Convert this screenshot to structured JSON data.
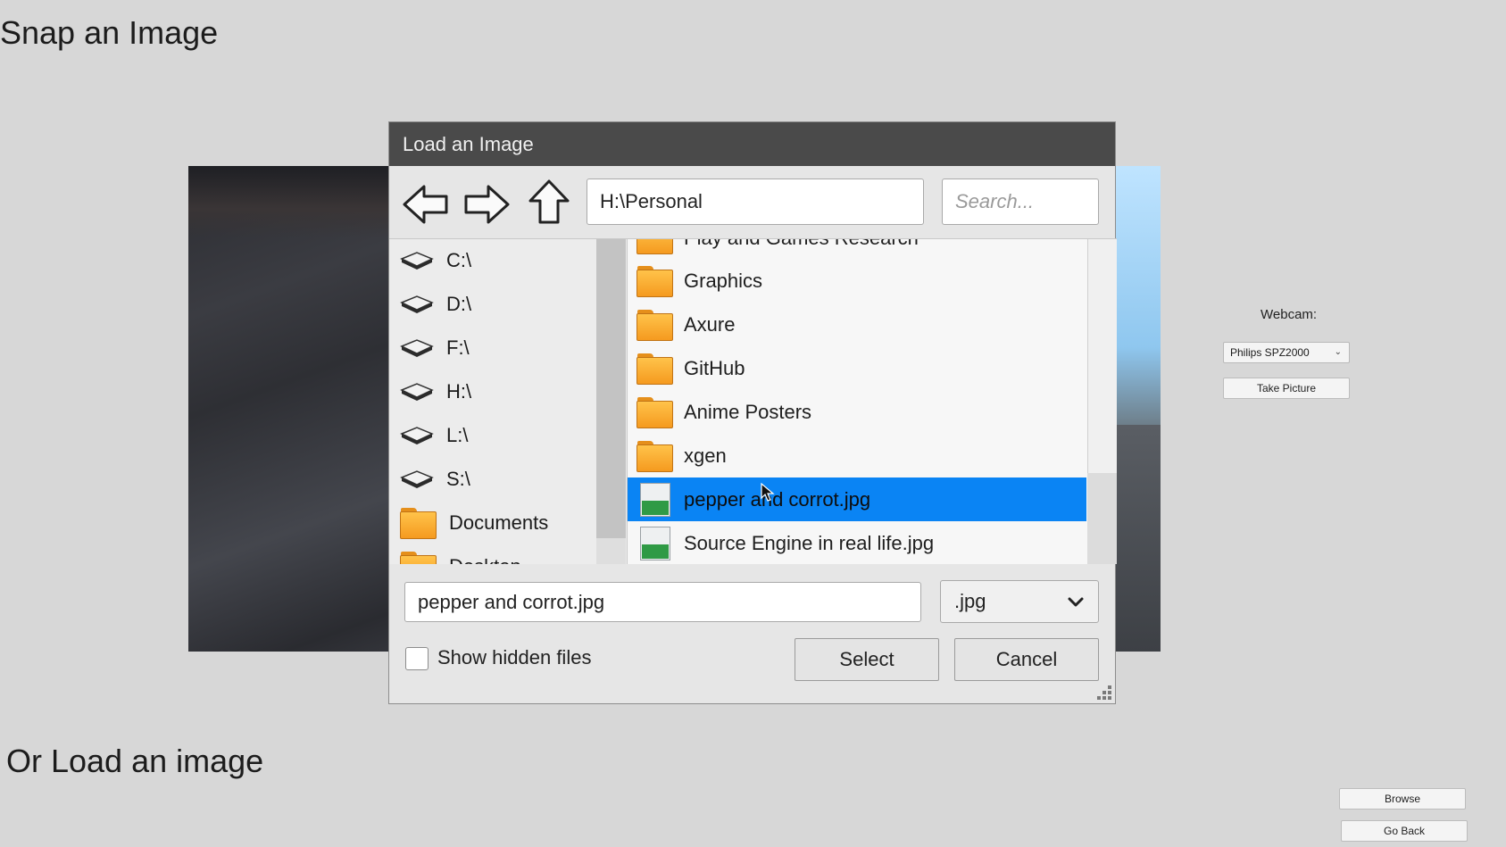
{
  "page": {
    "snap_heading": "Snap an Image",
    "load_heading": "Or Load an image"
  },
  "webcam": {
    "label": "Webcam:",
    "selected_device": "Philips SPZ2000",
    "take_picture_label": "Take Picture"
  },
  "actions": {
    "browse_label": "Browse",
    "go_back_label": "Go Back"
  },
  "dialog": {
    "title": "Load an Image",
    "path": "H:\\Personal",
    "search_placeholder": "Search...",
    "drives": [
      {
        "label": "C:\\",
        "icon": "drive-icon"
      },
      {
        "label": "D:\\",
        "icon": "drive-icon"
      },
      {
        "label": "F:\\",
        "icon": "drive-icon"
      },
      {
        "label": "H:\\",
        "icon": "drive-icon"
      },
      {
        "label": "L:\\",
        "icon": "drive-icon"
      },
      {
        "label": "S:\\",
        "icon": "drive-icon"
      },
      {
        "label": "Documents",
        "icon": "folder-icon"
      },
      {
        "label": "Desktop",
        "icon": "folder-icon"
      }
    ],
    "files": [
      {
        "label": "Play and Games Research",
        "type": "folder"
      },
      {
        "label": "Graphics",
        "type": "folder"
      },
      {
        "label": "Axure",
        "type": "folder"
      },
      {
        "label": "GitHub",
        "type": "folder"
      },
      {
        "label": "Anime Posters",
        "type": "folder"
      },
      {
        "label": "xgen",
        "type": "folder"
      },
      {
        "label": "pepper and corrot.jpg",
        "type": "image",
        "selected": true
      },
      {
        "label": "Source Engine in real life.jpg",
        "type": "image"
      }
    ],
    "filename": "pepper and corrot.jpg",
    "filetype": ".jpg",
    "show_hidden_label": "Show hidden files",
    "show_hidden_checked": false,
    "select_label": "Select",
    "cancel_label": "Cancel"
  },
  "colors": {
    "titlebar": "#4a4a4a",
    "selection": "#0a84f4",
    "background": "#d7d7d7"
  }
}
